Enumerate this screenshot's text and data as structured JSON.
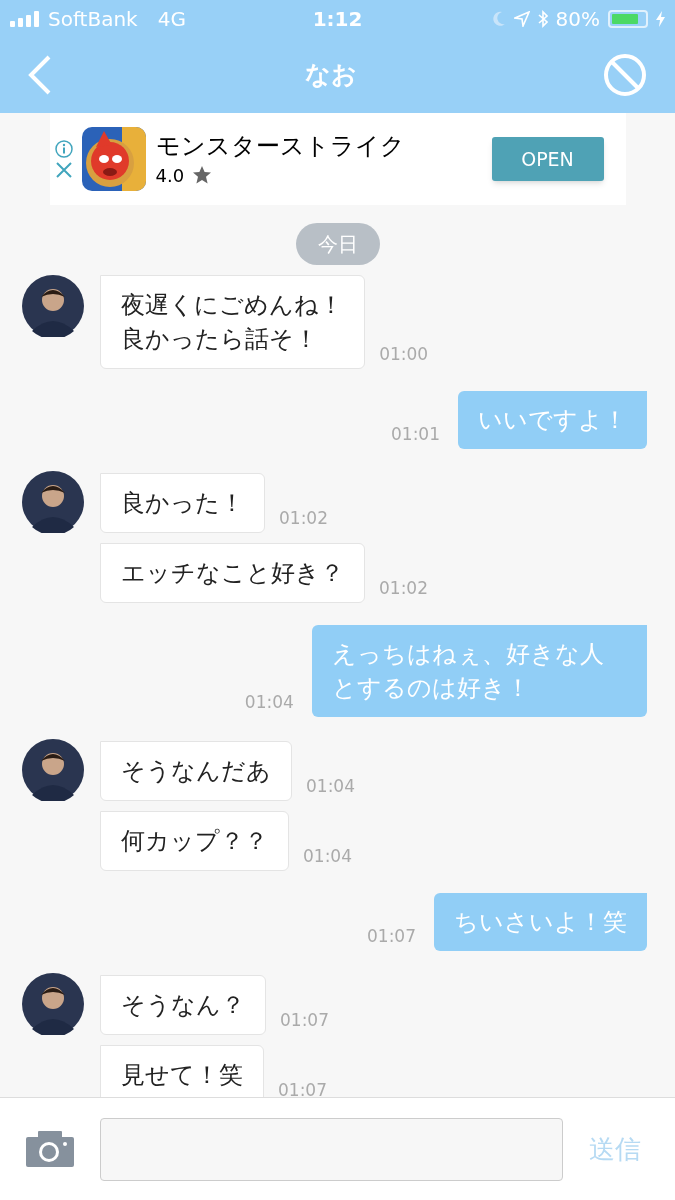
{
  "status_bar": {
    "carrier": "SoftBank",
    "network": "4G",
    "time": "1:12",
    "battery": "80%"
  },
  "nav": {
    "title": "なお"
  },
  "ad": {
    "app_name": "モンスターストライク",
    "rating": "4.0",
    "button": "OPEN"
  },
  "date_label": "今日",
  "messages": [
    {
      "kind": "in",
      "avatar": true,
      "text": "夜遅くにごめんね！良かったら話そ！",
      "time": "01:00"
    },
    {
      "kind": "out",
      "text": "いいですよ！",
      "time": "01:01"
    },
    {
      "kind": "in",
      "avatar": true,
      "text": "良かった！",
      "time": "01:02"
    },
    {
      "kind": "in",
      "avatar": false,
      "text": "エッチなこと好き？",
      "time": "01:02"
    },
    {
      "kind": "out",
      "text": "えっちはねぇ、好きな人とするのは好き！",
      "time": "01:04"
    },
    {
      "kind": "in",
      "avatar": true,
      "text": "そうなんだあ",
      "time": "01:04"
    },
    {
      "kind": "in",
      "avatar": false,
      "text": "何カップ？？",
      "time": "01:04"
    },
    {
      "kind": "out",
      "text": "ちいさいよ！笑",
      "time": "01:07"
    },
    {
      "kind": "in",
      "avatar": true,
      "text": "そうなん？",
      "time": "01:07"
    },
    {
      "kind": "in",
      "avatar": false,
      "text": "見せて！笑",
      "time": "01:07"
    }
  ],
  "composer": {
    "send": "送信"
  }
}
